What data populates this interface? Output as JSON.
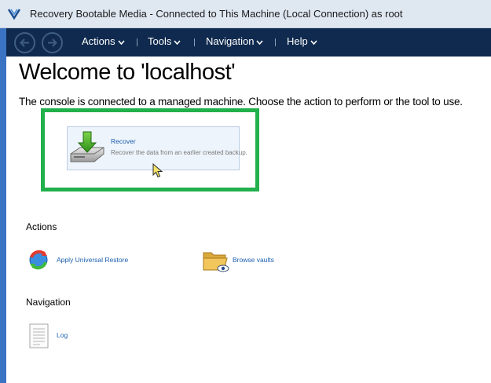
{
  "window": {
    "title": "Recovery Bootable Media - Connected to This Machine (Local Connection) as root",
    "app_icon": "acronis-logo-icon"
  },
  "menubar": {
    "back_icon": "back-arrow-icon",
    "forward_icon": "forward-arrow-icon",
    "items": [
      {
        "label": "Actions"
      },
      {
        "label": "Tools"
      },
      {
        "label": "Navigation"
      },
      {
        "label": "Help"
      }
    ]
  },
  "main": {
    "heading": "Welcome to 'localhost'",
    "intro": "The console is connected to a managed machine. Choose the action to perform or the tool to use.",
    "recover": {
      "title": "Recover",
      "description": "Recover the data from an earlier created backup.",
      "icon": "disk-recover-icon"
    },
    "highlight_color": "#22b04c",
    "actions": {
      "heading": "Actions",
      "items": [
        {
          "label": "Apply Universal Restore",
          "icon": "universal-restore-icon"
        },
        {
          "label": "Browse vaults",
          "icon": "vault-folder-icon"
        }
      ]
    },
    "navigation": {
      "heading": "Navigation",
      "items": [
        {
          "label": "Log",
          "icon": "log-document-icon"
        }
      ]
    }
  },
  "colors": {
    "menubar": "#0f2a4e",
    "link": "#1b5fae",
    "titlebar": "#dfe7f1"
  }
}
